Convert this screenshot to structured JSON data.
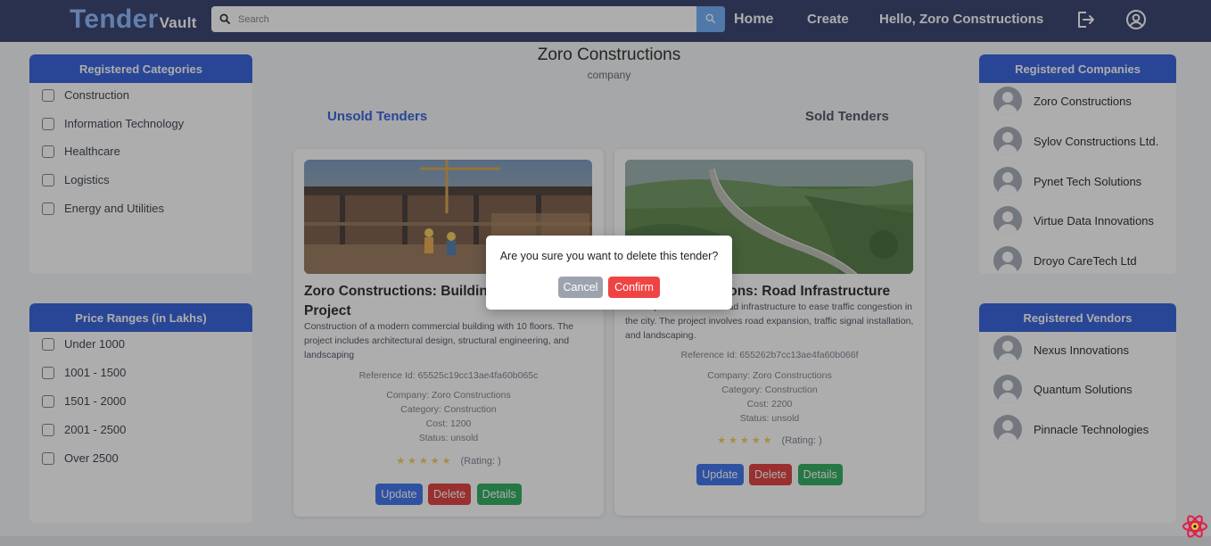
{
  "header": {
    "brand_main": "Tender",
    "brand_sub": "Vault",
    "search_placeholder": "Search",
    "nav_home": "Home",
    "nav_create": "Create",
    "nav_greeting": "Hello, Zoro Constructions",
    "icons": [
      "search-icon",
      "logout-icon",
      "user-circle-icon"
    ]
  },
  "categories_panel": {
    "title": "Registered Categories",
    "items": [
      "Construction",
      "Information Technology",
      "Healthcare",
      "Logistics",
      "Energy and Utilities"
    ]
  },
  "price_panel": {
    "title": "Price Ranges (in Lakhs)",
    "items": [
      "Under 1000",
      "1001 - 1500",
      "1501 - 2000",
      "2001 - 2500",
      "Over 2500"
    ]
  },
  "companies_panel": {
    "title": "Registered Companies",
    "items": [
      "Zoro Constructions",
      "Sylov Constructions Ltd.",
      "Pynet Tech Solutions",
      "Virtue Data Innovations",
      "Droyo CareTech Ltd"
    ]
  },
  "vendors_panel": {
    "title": "Registered Vendors",
    "items": [
      "Nexus Innovations",
      "Quantum Solutions",
      "Pinnacle Technologies"
    ]
  },
  "profile": {
    "name": "Zoro Constructions",
    "type": "company"
  },
  "tabs": {
    "unsold": "Unsold Tenders",
    "sold": "Sold Tenders"
  },
  "cards": [
    {
      "title_line1": "Zoro Constructions: Building",
      "title_line2": "Project",
      "description": "Construction of a modern commercial building with 10 floors. The project includes architectural design, structural engineering, and landscaping",
      "reference": "Reference Id: 65525c19cc13ae4fa60b065c",
      "company": "Company: Zoro Constructions",
      "category": "Category: Construction",
      "cost": "Cost: 1200",
      "status": "Status: unsold",
      "stars": "★★★★★",
      "rating": "(Rating: )",
      "update": "Update",
      "delete": "Delete",
      "details": "Details"
    },
    {
      "title_line1": "Zoro Constructions: Road Infrastructure",
      "description": "Development of urban road infrastructure to ease traffic congestion in the city. The project involves road expansion, traffic signal installation, and landscaping.",
      "reference": "Reference Id: 655262b7cc13ae4fa60b066f",
      "company": "Company: Zoro Constructions",
      "category": "Category: Construction",
      "cost": "Cost: 2200",
      "status": "Status: unsold",
      "stars": "★★★★★",
      "rating": "(Rating: )",
      "update": "Update",
      "delete": "Delete",
      "details": "Details"
    }
  ],
  "modal": {
    "message": "Are you sure you want to delete this tender?",
    "cancel": "Cancel",
    "confirm": "Confirm"
  },
  "colors": {
    "header_bg": "#1e2a5e",
    "accent": "#1d4ed8",
    "delete": "#dc2626",
    "details": "#16a34a"
  }
}
